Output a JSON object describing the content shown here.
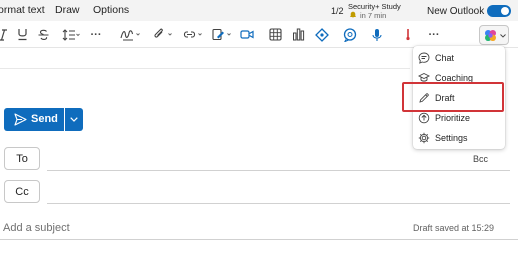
{
  "tabs": {
    "format_text": "ormat text",
    "draw": "Draw",
    "options": "Options"
  },
  "reminder": {
    "pager": "1/2",
    "title": "Security+ Study",
    "subtitle": "in 7 min"
  },
  "new_outlook": {
    "label": "New Outlook",
    "enabled": true
  },
  "ribbon": {
    "more_label": "···",
    "icons": [
      "italic-icon",
      "underline-icon",
      "strikethrough-icon",
      "line-spacing-icon",
      "more-icon",
      "highlighter-icon",
      "attach-icon",
      "link-icon",
      "signature-icon",
      "video-icon",
      "table-icon",
      "chart-icon",
      "tag-icon",
      "chat-bubble-icon",
      "microphone-icon",
      "pin-icon",
      "more-icon",
      "copilot-icon"
    ]
  },
  "compose": {
    "send_label": "Send",
    "to_label": "To",
    "cc_label": "Cc",
    "bcc_label": "Bcc",
    "subject_placeholder": "Add a subject",
    "saved_status": "Draft saved at 15:29"
  },
  "copilot_menu": {
    "items": [
      {
        "label": "Chat",
        "icon": "chat-icon"
      },
      {
        "label": "Coaching",
        "icon": "coaching-icon"
      },
      {
        "label": "Draft",
        "icon": "pen-icon"
      },
      {
        "label": "Prioritize",
        "icon": "prioritize-icon"
      },
      {
        "label": "Settings",
        "icon": "gear-icon"
      }
    ],
    "highlighted": "Draft"
  },
  "colors": {
    "accent": "#0f6cbd",
    "highlight": "#d13438"
  }
}
